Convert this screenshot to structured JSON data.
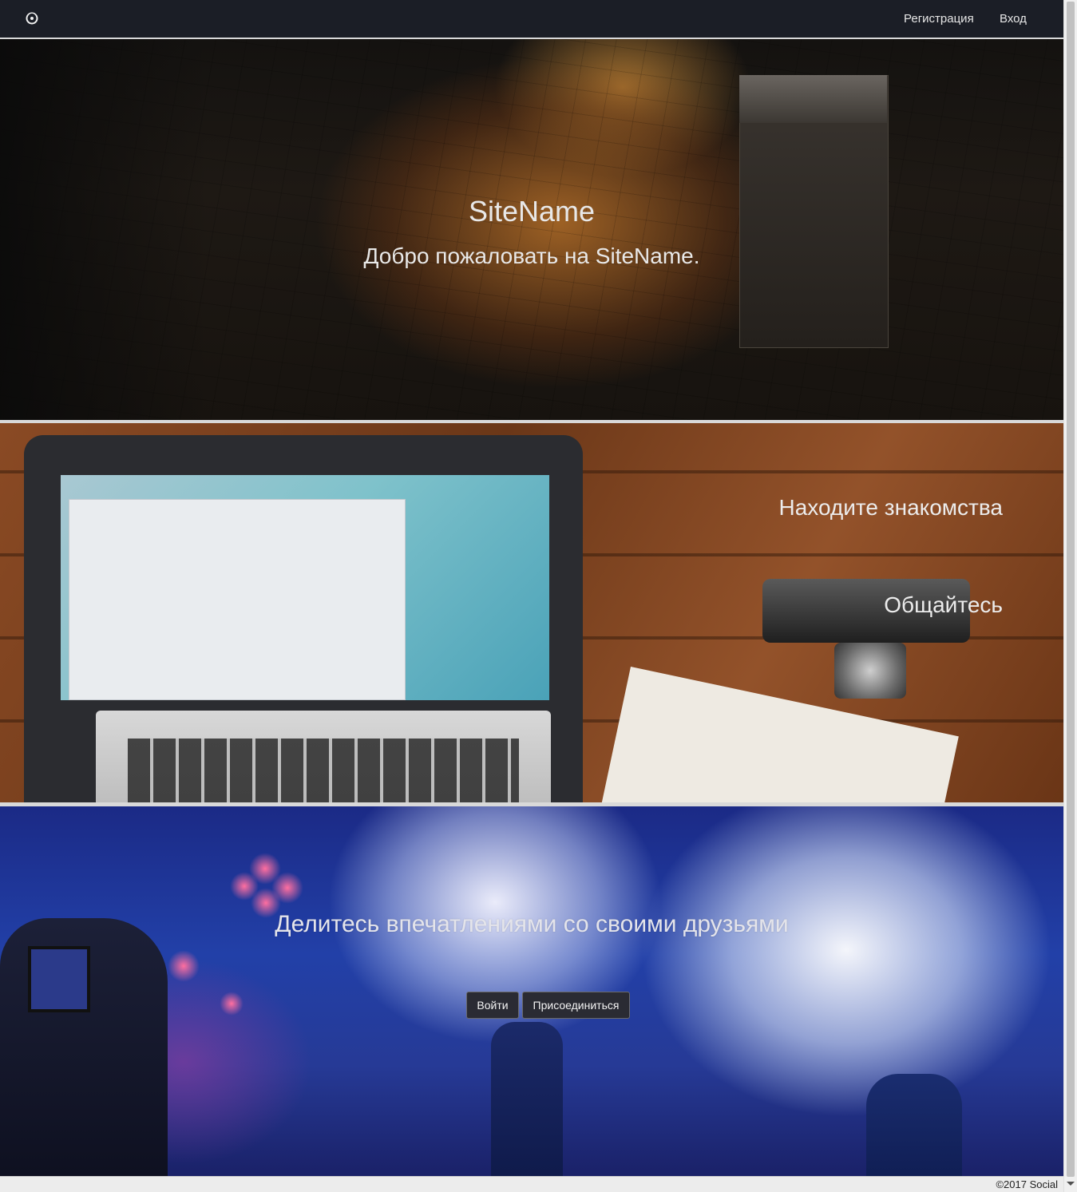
{
  "navbar": {
    "brand_icon": "ring-logo-icon",
    "register_label": "Регистрация",
    "login_label": "Вход"
  },
  "hero": {
    "title": "SiteName",
    "subtitle": "Добро пожаловать на SiteName."
  },
  "features": {
    "items": [
      "Находите знакомства",
      "Общайтесь"
    ]
  },
  "share": {
    "title": "Делитесь впечатлениями со своими друзьями",
    "login_button": "Войти",
    "join_button": "Присоединиться"
  },
  "footer": {
    "copyright": "©2017 Social"
  },
  "colors": {
    "navbar_bg": "#1b1e26",
    "button_bg": "#2a2b33",
    "text_light": "#e8e8e8"
  }
}
